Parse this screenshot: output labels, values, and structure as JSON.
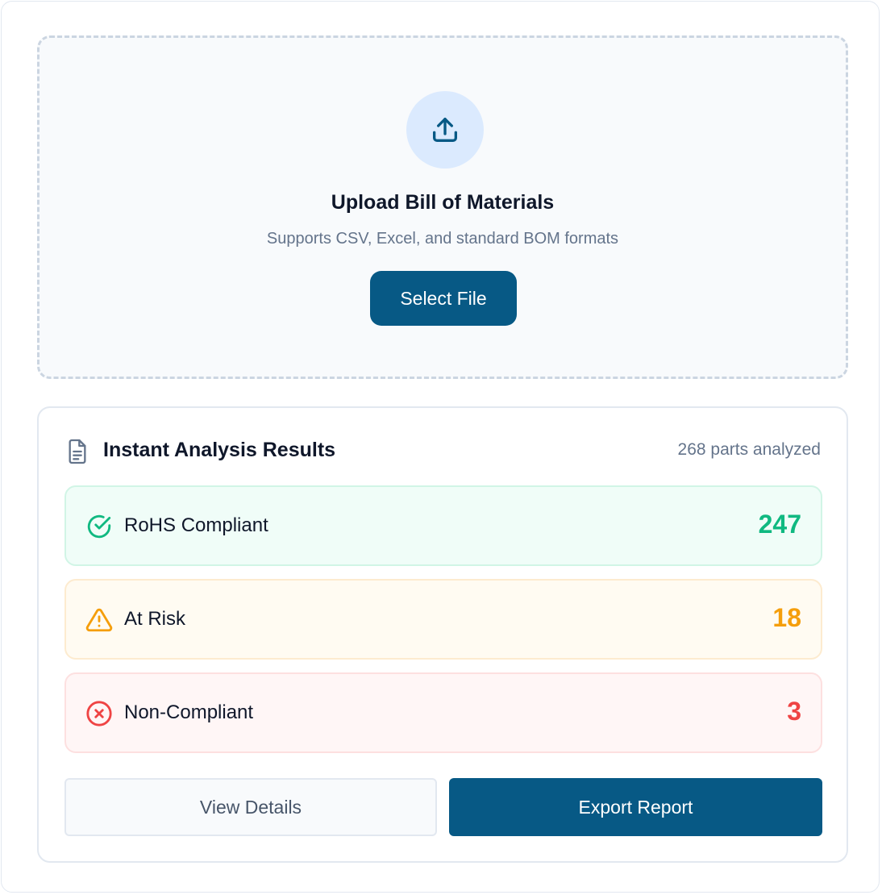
{
  "upload": {
    "icon": "upload-icon",
    "title": "Upload Bill of Materials",
    "subtitle": "Supports CSV, Excel, and standard BOM formats",
    "button_label": "Select File"
  },
  "results": {
    "icon": "document-icon",
    "title": "Instant Analysis Results",
    "count_text": "268 parts analyzed",
    "rows": [
      {
        "icon": "check-circle-icon",
        "label": "RoHS Compliant",
        "value": "247",
        "color": "#10b981"
      },
      {
        "icon": "warning-triangle-icon",
        "label": "At Risk",
        "value": "18",
        "color": "#f59e0b"
      },
      {
        "icon": "x-circle-icon",
        "label": "Non-Compliant",
        "value": "3",
        "color": "#ef4444"
      }
    ],
    "details_button": "View Details",
    "export_button": "Export Report"
  },
  "colors": {
    "primary": "#075985",
    "compliant": "#10b981",
    "risk": "#f59e0b",
    "noncompliant": "#ef4444"
  }
}
